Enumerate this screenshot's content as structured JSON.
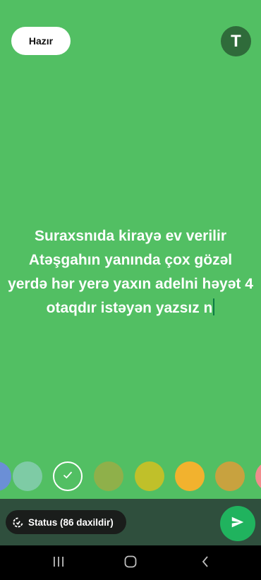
{
  "header": {
    "done_label": "Hazır",
    "font_button_label": "T"
  },
  "status": {
    "text": "Suraxsnıda kirayə ev verilir Atəşgahın yanında çox gözəl yerdə hər yerə yaxın  adelni həyət 4 otaqdır istəyən yazsız n",
    "background_color": "#52bf63",
    "text_color": "#ffffff"
  },
  "palette": {
    "colors": [
      "#6b8fd6",
      "#7ecba5",
      "#52bf63",
      "#8fb04a",
      "#c0c02a",
      "#f2b22e",
      "#c8a23f",
      "#f08c8c"
    ],
    "selected_index": 2
  },
  "bottom_bar": {
    "status_chip_label": "Status (86 daxildir)",
    "status_chip_icon": "status-ring-icon",
    "send_icon": "send-icon"
  },
  "nav": {
    "icons": [
      "recent-apps-icon",
      "home-icon",
      "back-icon"
    ]
  }
}
